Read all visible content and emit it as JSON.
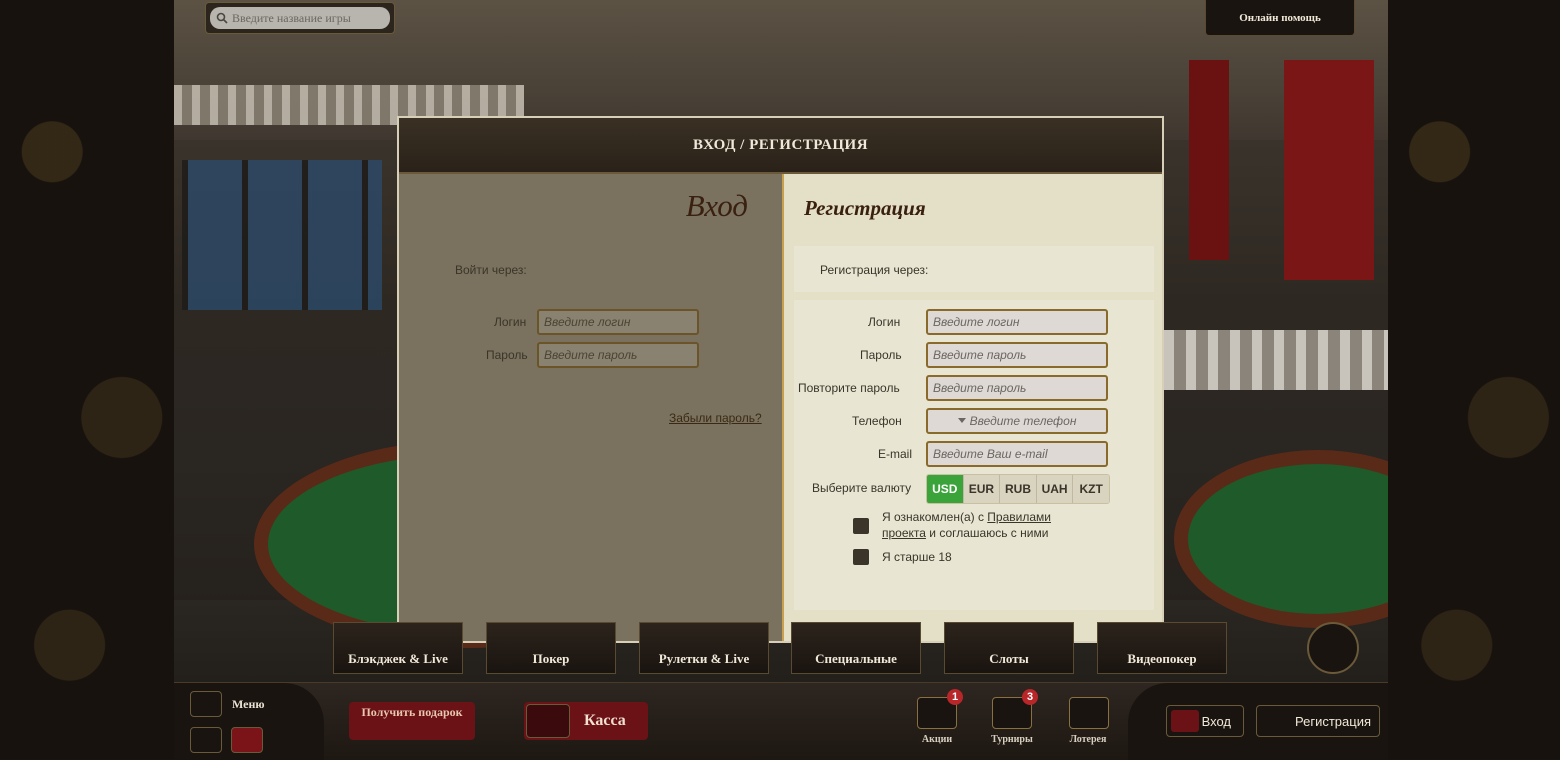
{
  "search": {
    "placeholder": "Введите название игры"
  },
  "header": {
    "help_label": "Онлайн помощь"
  },
  "modal": {
    "title": "ВХОД / РЕГИСТРАЦИЯ",
    "login": {
      "title": "Вход",
      "via_label": "Войти через:",
      "login_label": "Логин",
      "login_placeholder": "Введите логин",
      "password_label": "Пароль",
      "password_placeholder": "Введите пароль",
      "forgot": "Забыли пароль?"
    },
    "register": {
      "title": "Регистрация",
      "via_label": "Регистрация через:",
      "login_label": "Логин",
      "login_placeholder": "Введите логин",
      "password_label": "Пароль",
      "password_placeholder": "Введите пароль",
      "repeat_label": "Повторите пароль",
      "repeat_placeholder": "Введите пароль",
      "phone_label": "Телефон",
      "phone_placeholder": "Введите телефон",
      "email_label": "E-mail",
      "email_placeholder": "Введите Ваш e-mail",
      "currency_label": "Выберите валюту",
      "currencies": [
        "USD",
        "EUR",
        "RUB",
        "UAH",
        "KZT"
      ],
      "rules_pre": "Я ознакомлен(а) с ",
      "rules_link": "Правилами проекта",
      "rules_post": " и соглашаюсь с ними",
      "age": "Я старше 18"
    }
  },
  "categories": [
    "Блэкджек & Live",
    "Покер",
    "Рулетки & Live",
    "Специальные",
    "Слоты",
    "Видеопокер"
  ],
  "bottom": {
    "menu": "Меню",
    "gift": "Получить подарок",
    "kassa": "Касса",
    "promos": [
      {
        "label": "Акции",
        "badge": "1"
      },
      {
        "label": "Турниры",
        "badge": "3"
      },
      {
        "label": "Лотерея",
        "badge": ""
      }
    ],
    "login": "Вход",
    "register": "Регистрация"
  },
  "colors": {
    "accent_green": "#3aa33a",
    "brand_red": "#6a1216",
    "gold_border": "#8a6a2a"
  }
}
